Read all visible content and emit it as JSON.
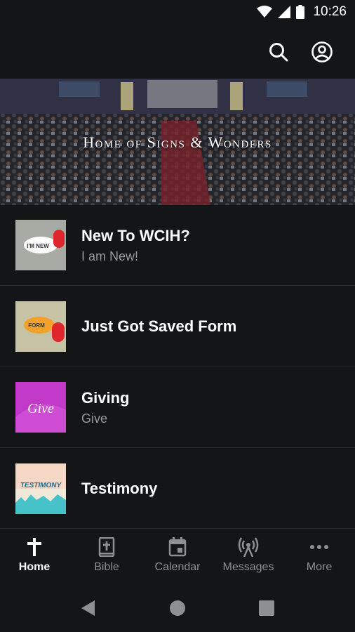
{
  "status": {
    "time": "10:26"
  },
  "hero": {
    "title": "Home of Signs & Wonders"
  },
  "list": [
    {
      "title": "New To WCIH?",
      "subtitle": "I am New!",
      "thumb_text": "I'M NEW"
    },
    {
      "title": "Just Got Saved Form",
      "subtitle": "",
      "thumb_text": "FORM"
    },
    {
      "title": "Giving",
      "subtitle": "Give",
      "thumb_text": "Give"
    },
    {
      "title": "Testimony",
      "subtitle": "",
      "thumb_text": "TESTIMONY"
    }
  ],
  "nav": {
    "home": "Home",
    "bible": "Bible",
    "calendar": "Calendar",
    "messages": "Messages",
    "more": "More"
  },
  "colors": {
    "background": "#141517",
    "divider": "#2b2c2f",
    "inactive": "#8e8f93"
  }
}
